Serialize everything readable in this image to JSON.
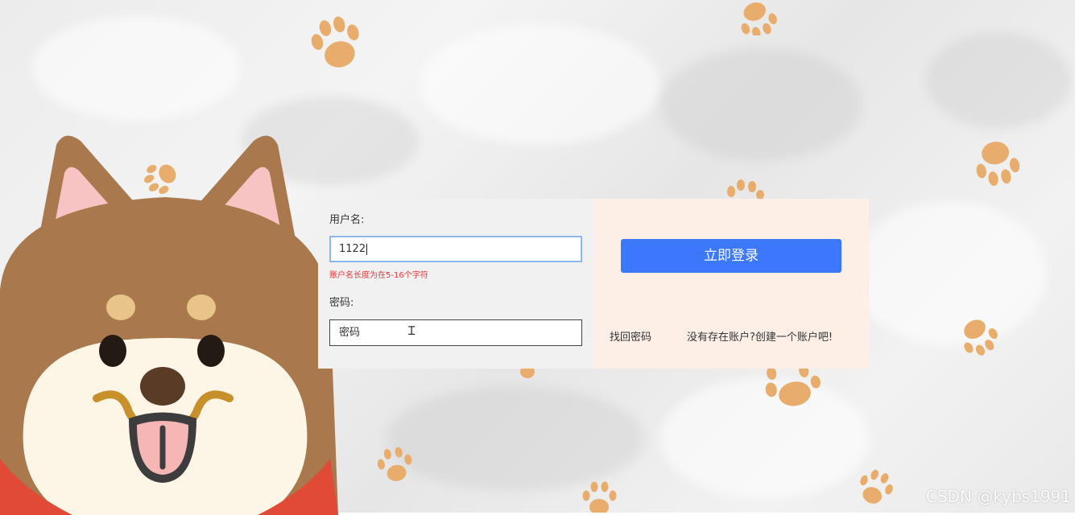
{
  "form": {
    "username_label": "用户名:",
    "username_value": "1122",
    "username_error": "账户名长度为在5-16个字符",
    "password_label": "密码:",
    "password_placeholder": "密码"
  },
  "actions": {
    "login_label": "立即登录",
    "forgot_password": "找回密码",
    "register": "没有存在账户?创建一个账户吧!"
  },
  "watermark": "CSDN @kybs1991",
  "colors": {
    "login_button": "#3b78fb",
    "error_text": "#e23b3b",
    "paw": "#e8ad6c",
    "dog_fur": "#a9784d",
    "right_panel": "#fdeee6"
  },
  "icons": [
    "paw-print-icon",
    "shiba-dog-illustration",
    "text-cursor-icon"
  ]
}
